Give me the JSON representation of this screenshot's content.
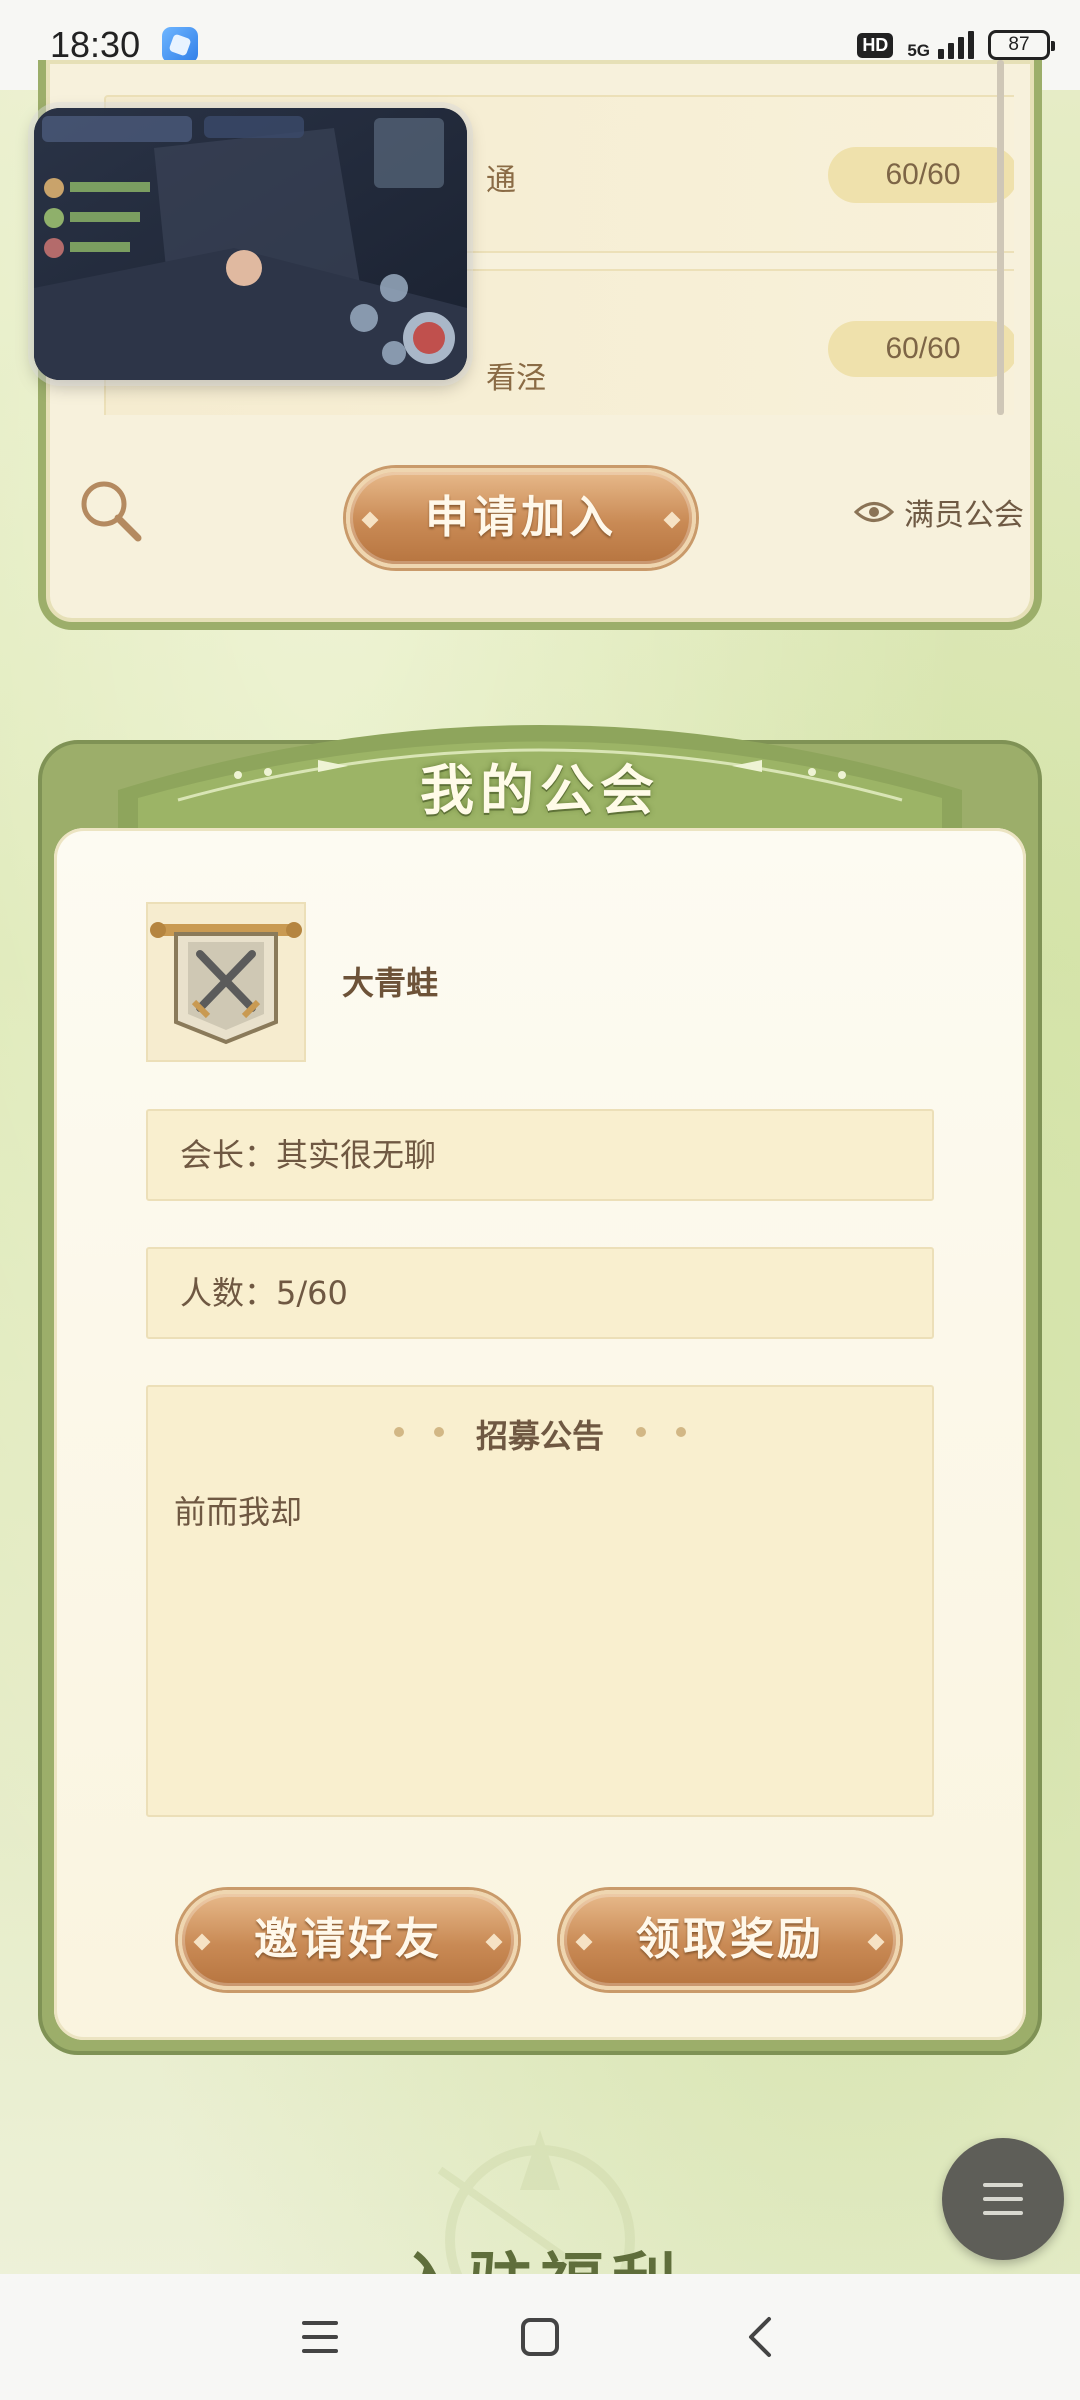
{
  "status_bar": {
    "time": "18:30",
    "hd": "HD",
    "network": "5G",
    "battery": "87"
  },
  "guild_list": {
    "rows": [
      {
        "name_partial": "通",
        "count": "60/60"
      },
      {
        "name_partial": "看泾",
        "count": "60/60"
      }
    ],
    "apply_button": "申请加入",
    "full_guild_label": "满员公会"
  },
  "my_guild": {
    "title": "我的公会",
    "name": "大青蛙",
    "leader": "会长：其实很无聊",
    "members": "人数：5/60",
    "recruit_title": "招募公告",
    "recruit_text": "前而我却",
    "invite_button": "邀请好友",
    "reward_button": "领取奖励"
  },
  "bottom": {
    "heading_partial": "入驻福利"
  },
  "icons": {
    "search": "search-icon",
    "eye": "eye-icon",
    "menu": "menu-icon",
    "emblem": "crossed-swords-banner-icon"
  },
  "colors": {
    "panel_green": "#9cae6a",
    "button_brown": "#c98a55",
    "text_brown": "#6f5842",
    "fab_gray": "#5e5e58"
  }
}
